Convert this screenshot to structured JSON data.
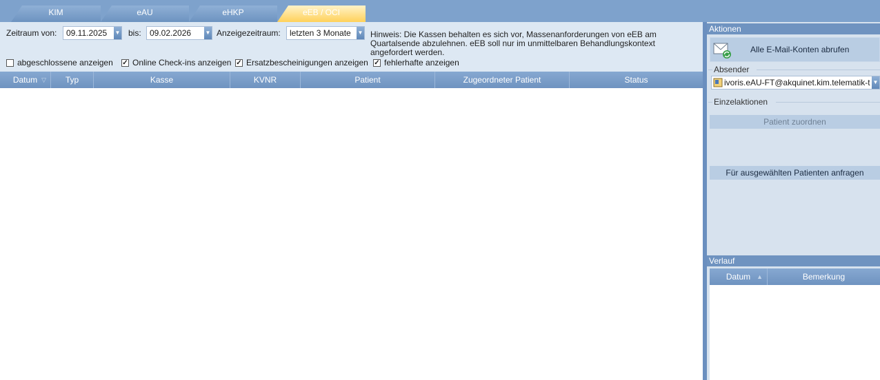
{
  "tabs": [
    "KIM",
    "eAU",
    "eHKP",
    "eEB / OCI"
  ],
  "filter": {
    "zeitraum_von_label": "Zeitraum von:",
    "zeitraum_von_value": "09.11.2025",
    "bis_label": "bis:",
    "bis_value": "09.02.2026",
    "anzeigezeitraum_label": "Anzeigezeitraum:",
    "anzeigezeitraum_value": "letzten 3 Monate",
    "hint": "Hinweis: Die Kassen behalten es sich vor, Massenanforderungen von eEB am Quartalsende abzulehnen. eEB soll nur im unmittelbaren Behandlungskontext angefordert werden."
  },
  "checkboxes": [
    {
      "label": "abgeschlossene anzeigen",
      "checked": false
    },
    {
      "label": "Online Check-ins anzeigen",
      "checked": true
    },
    {
      "label": "Ersatzbescheinigungen anzeigen",
      "checked": true
    },
    {
      "label": "fehlerhafte anzeigen",
      "checked": true
    }
  ],
  "grid": {
    "columns": [
      "Datum",
      "Typ",
      "Kasse",
      "KVNR",
      "Patient",
      "Zugeordneter Patient",
      "Status"
    ],
    "rows": []
  },
  "aktionen": {
    "title": "Aktionen",
    "mail_button": "Alle E-Mail-Konten abrufen",
    "absender_label": "Absender",
    "absender_value": "ivoris.eAU-FT@akquinet.kim.telematik-t",
    "einzelaktionen_label": "Einzelaktionen",
    "patient_zuordnen": "Patient zuordnen",
    "anfragen": "Für ausgewählten Patienten anfragen"
  },
  "verlauf": {
    "title": "Verlauf",
    "columns": [
      "Datum",
      "Bemerkung"
    ]
  },
  "colors": {
    "accent": "#7ea2cc",
    "active_tab": "#ffd15a",
    "panel": "#dde8f3"
  }
}
